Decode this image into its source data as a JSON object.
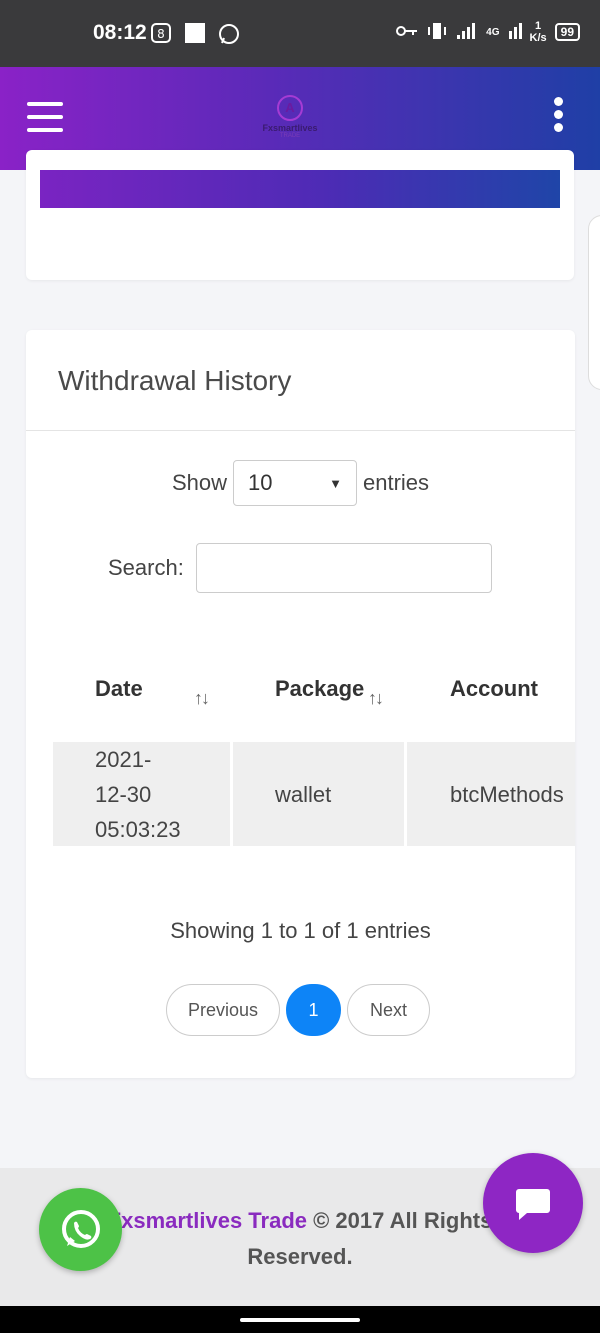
{
  "status_bar": {
    "time": "08:12",
    "network": "4G",
    "speed_value": "1",
    "speed_unit": "K/s",
    "battery": "99"
  },
  "navbar": {
    "logo_text": "Fxsmartlives",
    "logo_sub": "TRADE"
  },
  "withdrawal": {
    "title": "Withdrawal History",
    "show_label": "Show",
    "entries_select": "10",
    "entries_label": "entries",
    "search_label": "Search:",
    "columns": [
      "Date",
      "Package",
      "Account"
    ],
    "rows": [
      {
        "date": [
          "2021-",
          "12-30",
          "05:03:23"
        ],
        "package": "wallet",
        "account": "btcMethods"
      }
    ],
    "info": "Showing 1 to 1 of 1 entries",
    "pagination": {
      "previous": "Previous",
      "current": "1",
      "next": "Next"
    }
  },
  "footer": {
    "brand": "Fxsmartlives Trade",
    "copyright": " © 2017 All Rights",
    "reserved": "Reserved."
  },
  "colors": {
    "accent_purple": "#8a22c7",
    "accent_blue": "#1f3fa6",
    "pager_active": "#0d84f7",
    "whatsapp": "#4dc247",
    "chat": "#8e26c4"
  }
}
